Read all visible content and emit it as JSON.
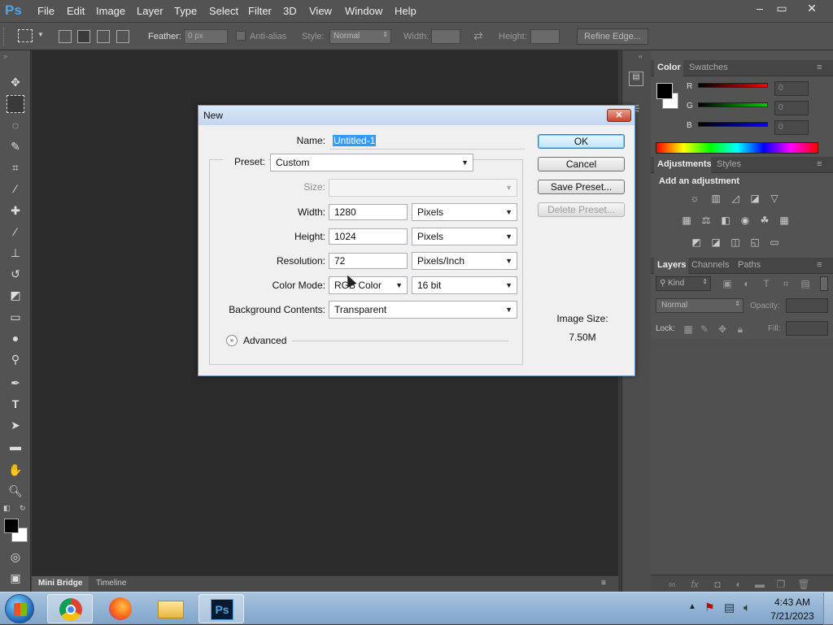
{
  "app": {
    "menu": [
      "File",
      "Edit",
      "Image",
      "Layer",
      "Type",
      "Select",
      "Filter",
      "3D",
      "View",
      "Window",
      "Help"
    ],
    "logo": "Ps",
    "window_buttons": [
      "–",
      "▭",
      "✕"
    ]
  },
  "options_bar": {
    "feather_label": "Feather:",
    "feather_value": "0 px",
    "antialias_label": "Anti-alias",
    "style_label": "Style:",
    "style_value": "Normal",
    "width_label": "Width:",
    "height_label": "Height:",
    "refine_edge": "Refine Edge..."
  },
  "bottom_tabs": [
    "Mini Bridge",
    "Timeline"
  ],
  "color_panel": {
    "tabs": [
      "Color",
      "Swatches"
    ],
    "channels": [
      {
        "label": "R",
        "value": "0",
        "color": "#ff0000"
      },
      {
        "label": "G",
        "value": "0",
        "color": "#00cc00"
      },
      {
        "label": "B",
        "value": "0",
        "color": "#0000ff"
      }
    ]
  },
  "adjustments_panel": {
    "tabs": [
      "Adjustments",
      "Styles"
    ],
    "heading": "Add an adjustment"
  },
  "layers_panel": {
    "tabs": [
      "Layers",
      "Channels",
      "Paths"
    ],
    "kind_label": "Kind",
    "blend_mode": "Normal",
    "opacity_label": "Opacity:",
    "lock_label": "Lock:",
    "fill_label": "Fill:"
  },
  "dialog": {
    "title": "New",
    "name_label": "Name:",
    "name_value": "Untitled-1",
    "preset_label": "Preset:",
    "preset_value": "Custom",
    "size_label": "Size:",
    "width_label": "Width:",
    "width_value": "1280",
    "width_unit": "Pixels",
    "height_label": "Height:",
    "height_value": "1024",
    "height_unit": "Pixels",
    "resolution_label": "Resolution:",
    "resolution_value": "72",
    "resolution_unit": "Pixels/Inch",
    "color_mode_label": "Color Mode:",
    "color_mode_value": "RGB Color",
    "bit_depth": "16 bit",
    "background_label": "Background Contents:",
    "background_value": "Transparent",
    "advanced_label": "Advanced",
    "ok": "OK",
    "cancel": "Cancel",
    "save_preset": "Save Preset...",
    "delete_preset": "Delete Preset...",
    "image_size_label": "Image Size:",
    "image_size_value": "7.50M"
  },
  "taskbar": {
    "time": "4:43 AM",
    "date": "7/21/2023",
    "apps": [
      "chrome",
      "firefox",
      "file-explorer",
      "photoshop"
    ]
  }
}
